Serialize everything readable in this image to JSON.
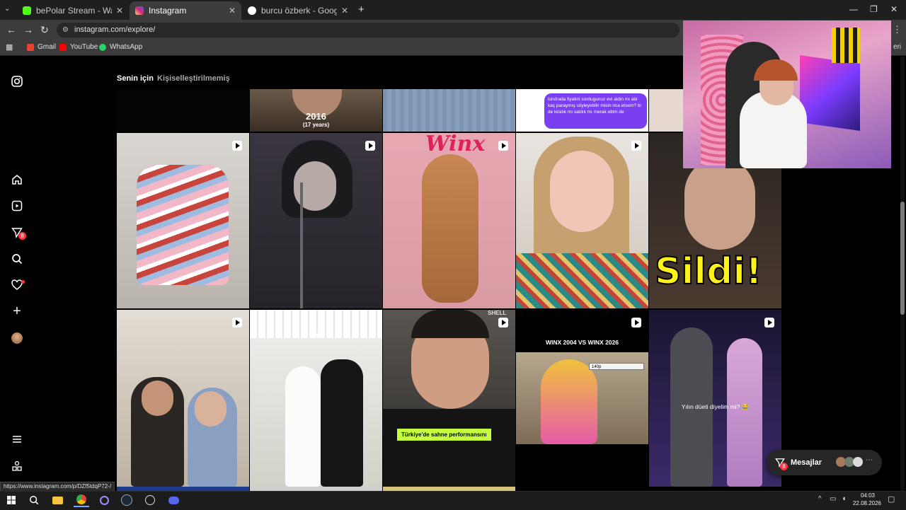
{
  "browser": {
    "tabs": [
      {
        "title": "bePolar Stream - Watch Live on",
        "icon_color": "#53fc18",
        "icon_glyph": "K"
      },
      {
        "title": "Instagram",
        "icon_color": "#d62976",
        "icon_glyph": "◎"
      },
      {
        "title": "burcu özberk - Google'da Ara",
        "icon_color": "#ffffff",
        "icon_glyph": "G"
      }
    ],
    "new_tab": "+",
    "url": "instagram.com/explore/",
    "bookmarks": [
      {
        "label": "Gmail",
        "color": "#ea4335"
      },
      {
        "label": "YouTube",
        "color": "#ff0000"
      },
      {
        "label": "WhatsApp",
        "color": "#25d366"
      }
    ],
    "bookmarks_overflow": "eri"
  },
  "instagram": {
    "tabs": [
      "Senin için",
      "Kişiselleştirilmemiş"
    ],
    "notification_badge": "8",
    "messages_badge": "8",
    "messages_label": "Mesajlar"
  },
  "tiles": {
    "top_caption_year": "2016",
    "top_caption_sub": "(17 years)",
    "chat_text": "londrada fiyatini sordugunuz evi aldin mı abi kaç paraymış söyleyebilir misin rica etsem? bi de kiralık mı satılık mı merak ettim de",
    "winx_logo": "Winx",
    "sildi": "Sildi!",
    "turkiye_caption": "Türkiye'de sahne performansını",
    "winx_compare": "WINX 2004 VS WINX 2026",
    "quality_label": "140p",
    "duet_caption": "Yılın düeti diyelim mi? 😂",
    "shells_text": "SHELL"
  },
  "status_url": "https://www.instagram.com/p/DZf5tdqP72-/",
  "taskbar": {
    "time": "04:03",
    "date": "22.08.2026"
  }
}
